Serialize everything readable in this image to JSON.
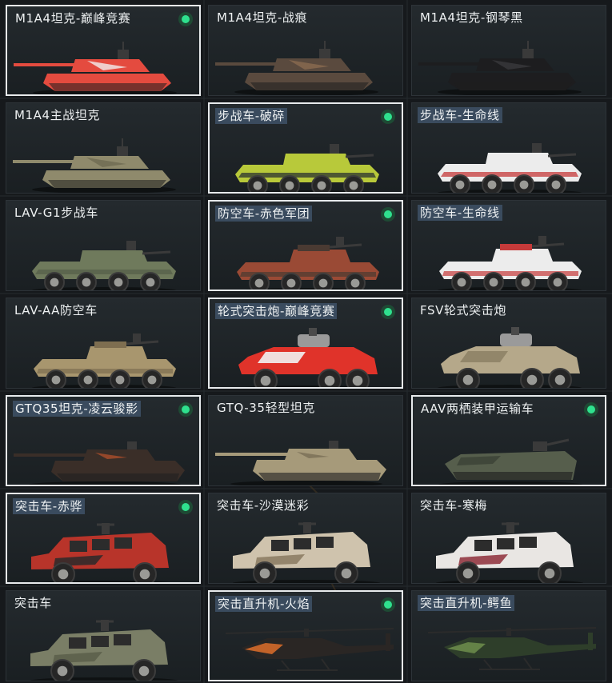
{
  "skins": [
    {
      "name": "M1A4坦克-巅峰竞赛",
      "kind": "tank",
      "color": "#e44b3f",
      "accent": "#f1eeee",
      "selected": true,
      "equipped": true,
      "highlight": false
    },
    {
      "name": "M1A4坦克-战痕",
      "kind": "tank",
      "color": "#5a4a3e",
      "accent": "#8a6a50",
      "selected": false,
      "equipped": false,
      "highlight": false
    },
    {
      "name": "M1A4坦克-钢琴黑",
      "kind": "tank",
      "color": "#1d1d1f",
      "accent": "#3a3a3c",
      "selected": false,
      "equipped": false,
      "highlight": false
    },
    {
      "name": "M1A4主战坦克",
      "kind": "tank",
      "color": "#8f8a6c",
      "accent": "#6e6a52",
      "selected": false,
      "equipped": false,
      "highlight": false
    },
    {
      "name": "步战车-破碎",
      "kind": "ifv",
      "color": "#b8c93a",
      "accent": "#2b3230",
      "selected": true,
      "equipped": true,
      "highlight": true
    },
    {
      "name": "步战车-生命线",
      "kind": "ifv",
      "color": "#ececec",
      "accent": "#c63a3a",
      "selected": false,
      "equipped": false,
      "highlight": true
    },
    {
      "name": "LAV-G1步战车",
      "kind": "ifv",
      "color": "#6f7a5c",
      "accent": "#56604a",
      "selected": false,
      "equipped": false,
      "highlight": false
    },
    {
      "name": "防空车-赤色军团",
      "kind": "aa",
      "color": "#9a4a35",
      "accent": "#4a3a32",
      "selected": true,
      "equipped": true,
      "highlight": true
    },
    {
      "name": "防空车-生命线",
      "kind": "aa",
      "color": "#ececec",
      "accent": "#c63a3a",
      "selected": false,
      "equipped": false,
      "highlight": true
    },
    {
      "name": "LAV-AA防空车",
      "kind": "aa",
      "color": "#a8966e",
      "accent": "#7e6e50",
      "selected": false,
      "equipped": false,
      "highlight": false
    },
    {
      "name": "轮式突击炮-巅峰竞赛",
      "kind": "wheeled",
      "color": "#e0332a",
      "accent": "#f2f2f2",
      "selected": true,
      "equipped": true,
      "highlight": true
    },
    {
      "name": "FSV轮式突击炮",
      "kind": "wheeled",
      "color": "#b5a88a",
      "accent": "#8e8266",
      "selected": false,
      "equipped": false,
      "highlight": false
    },
    {
      "name": "GTQ35坦克-凌云骏影",
      "kind": "light",
      "color": "#3a2e28",
      "accent": "#a04a2a",
      "selected": true,
      "equipped": true,
      "highlight": true
    },
    {
      "name": "GTQ-35轻型坦克",
      "kind": "light",
      "color": "#a69a7a",
      "accent": "#7e735a",
      "selected": false,
      "equipped": false,
      "highlight": false
    },
    {
      "name": "AAV两栖装甲运输车",
      "kind": "aav",
      "color": "#565e4c",
      "accent": "#3e4538",
      "selected": true,
      "equipped": true,
      "highlight": false
    },
    {
      "name": "突击车-赤骅",
      "kind": "assault",
      "color": "#b8342a",
      "accent": "#2a2a2a",
      "selected": true,
      "equipped": true,
      "highlight": true
    },
    {
      "name": "突击车-沙漠迷彩",
      "kind": "assault",
      "color": "#cfc3ad",
      "accent": "#8a7a60",
      "selected": false,
      "equipped": false,
      "highlight": false
    },
    {
      "name": "突击车-寒梅",
      "kind": "assault",
      "color": "#e9e6e3",
      "accent": "#8e2e3a",
      "selected": false,
      "equipped": false,
      "highlight": false
    },
    {
      "name": "突击车",
      "kind": "assault",
      "color": "#7a7e66",
      "accent": "#5a5e4a",
      "selected": false,
      "equipped": false,
      "highlight": false
    },
    {
      "name": "突击直升机-火焰",
      "kind": "heli",
      "color": "#2a2624",
      "accent": "#d46a2a",
      "selected": true,
      "equipped": true,
      "highlight": true
    },
    {
      "name": "突击直升机-鳄鱼",
      "kind": "heli",
      "color": "#2e3e2a",
      "accent": "#6a8a4a",
      "selected": false,
      "equipped": false,
      "highlight": true
    }
  ]
}
